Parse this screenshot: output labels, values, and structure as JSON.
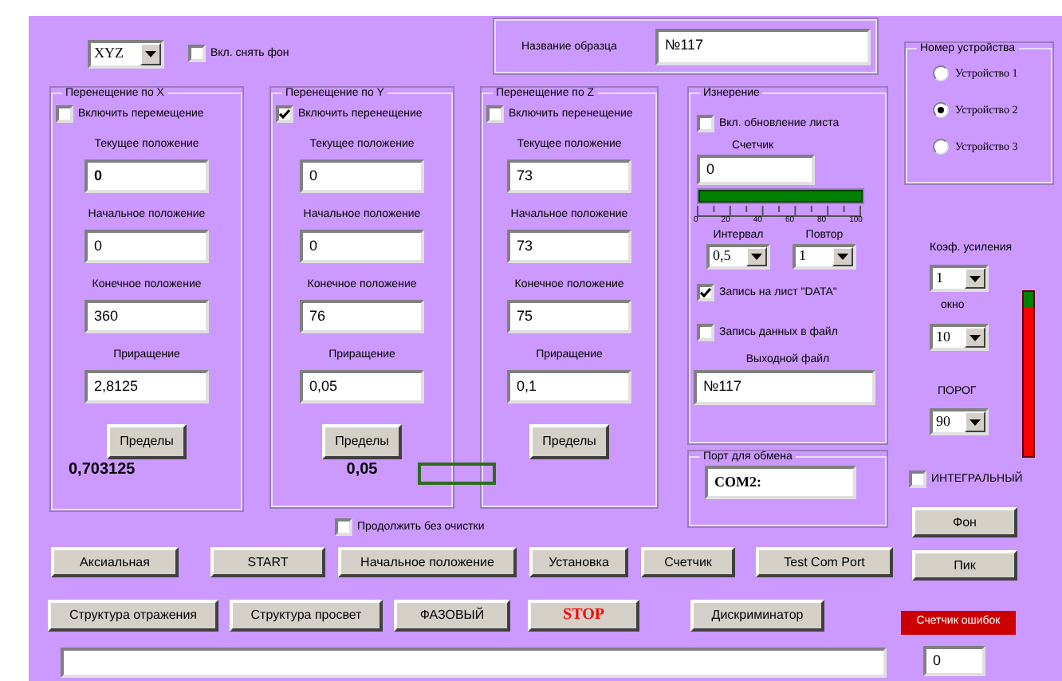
{
  "axis_select": {
    "value": "XYZ"
  },
  "subtract_background": {
    "label": "Вкл. снять фон",
    "checked": false
  },
  "sample_name": {
    "label": "Название образца",
    "value": "№117"
  },
  "axes": [
    {
      "title": "Перенещение по X",
      "enable": {
        "label": "Включить перемещение",
        "checked": false
      },
      "fields": [
        {
          "label": "Текущее положение",
          "value": "0",
          "bold": true
        },
        {
          "label": "Начальное положение",
          "value": "0",
          "bold": false
        },
        {
          "label": "Конечное положение",
          "value": "360",
          "bold": false
        },
        {
          "label": "Приращение",
          "value": "2,8125",
          "bold": false
        }
      ],
      "limits_button": "Пределы",
      "step_value": "0,703125"
    },
    {
      "title": "Перенещение по Y",
      "enable": {
        "label": "Включить перенещение",
        "checked": true
      },
      "fields": [
        {
          "label": "Текущее положение",
          "value": "0",
          "bold": false
        },
        {
          "label": "Начальное положение",
          "value": "0",
          "bold": false
        },
        {
          "label": "Конечное положение",
          "value": "76",
          "bold": false
        },
        {
          "label": "Приращение",
          "value": "0,05",
          "bold": false
        }
      ],
      "limits_button": "Пределы",
      "step_value": "0,05"
    },
    {
      "title": "Перенещение по Z",
      "enable": {
        "label": "Включить перенещение",
        "checked": false
      },
      "fields": [
        {
          "label": "Текущее положение",
          "value": "73",
          "bold": false
        },
        {
          "label": "Начальное положение",
          "value": "73",
          "bold": false
        },
        {
          "label": "Конечное положение",
          "value": "75",
          "bold": false
        },
        {
          "label": "Приращение",
          "value": "0,1",
          "bold": false
        }
      ],
      "limits_button": "Пределы"
    }
  ],
  "measurement": {
    "title": "Изнерение",
    "update_sheet": {
      "label": "Вкл. обновление листа",
      "checked": false
    },
    "counter_label": "Счетчик",
    "counter_value": "0",
    "progress": {
      "level": 1.0
    },
    "scale_labels": [
      "0",
      "20",
      "40",
      "60",
      "80",
      "100"
    ],
    "interval": {
      "label": "Интервал",
      "value": "0,5"
    },
    "repeat": {
      "label": "Повтор",
      "value": "1"
    },
    "write_sheet": {
      "label": "Запись на лист \"DATA\"",
      "checked": true
    },
    "write_file": {
      "label": "Запись данных в файл",
      "checked": false
    },
    "output_file": {
      "label": "Выходной файл",
      "value": "№117"
    }
  },
  "port": {
    "label": "Порт для обмена",
    "value": "COM2:"
  },
  "device": {
    "title": "Номер устройства",
    "options": [
      {
        "label": "Устройство 1",
        "selected": false
      },
      {
        "label": "Устройство 2",
        "selected": true
      },
      {
        "label": "Устройство 3",
        "selected": false
      }
    ]
  },
  "gain": {
    "label": "Коэф. усиления",
    "value": "1"
  },
  "window": {
    "label": "окно",
    "value": "10"
  },
  "threshold": {
    "label": "ПОРОГ",
    "value": "90"
  },
  "signal_meter": {
    "level": 0.1
  },
  "integral": {
    "label": "ИНТЕГРАЛЬНЫЙ",
    "checked": false
  },
  "side_buttons": [
    "Фон",
    "Пик"
  ],
  "continue_without_clear": {
    "label": "Продолжить без очистки",
    "checked": false
  },
  "buttons_row1": [
    {
      "label": "Аксиальная",
      "kind": "normal"
    },
    {
      "label": "START",
      "kind": "normal"
    },
    {
      "label": "Начальное положение",
      "kind": "normal"
    },
    {
      "label": "Установка",
      "kind": "normal"
    },
    {
      "label": "Счетчик",
      "kind": "normal"
    },
    {
      "label": "Test Com Port",
      "kind": "normal"
    }
  ],
  "buttons_row2": [
    {
      "label": "Структура отражения",
      "kind": "normal"
    },
    {
      "label": "Структура просвет",
      "kind": "normal"
    },
    {
      "label": "ФАЗОВЫЙ",
      "kind": "normal"
    },
    {
      "label": "STOP",
      "kind": "stop"
    },
    {
      "label": "Дискриминатор",
      "kind": "normal"
    }
  ],
  "error_counter": {
    "label": "Счетчик ошибок",
    "value": "0"
  }
}
